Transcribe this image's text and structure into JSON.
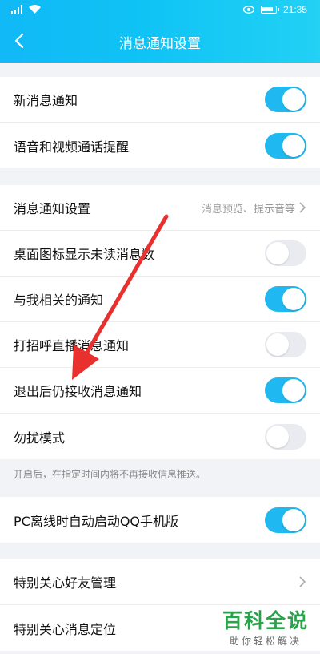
{
  "status_bar": {
    "time": "21:35",
    "icons": [
      "signal-icon",
      "wifi-icon",
      "eye-icon",
      "battery-icon"
    ]
  },
  "header": {
    "title": "消息通知设置",
    "back_icon": "chevron-left-icon"
  },
  "colors": {
    "header_start": "#11b9f6",
    "header_end": "#22d1f4",
    "toggle_on": "#20b8f0",
    "toggle_off": "#e9ebf0",
    "arrow": "#e8302e",
    "watermark": "#2aa24a"
  },
  "group1": {
    "items": [
      {
        "label": "新消息通知",
        "toggle": true
      },
      {
        "label": "语音和视频通话提醒",
        "toggle": true
      }
    ]
  },
  "group2": {
    "items": [
      {
        "label": "消息通知设置",
        "value": "消息预览、提示音等"
      },
      {
        "label": "桌面图标显示未读消息数",
        "toggle": false
      },
      {
        "label": "与我相关的通知",
        "toggle": true
      },
      {
        "label": "打招呼直播消息通知",
        "toggle": false
      },
      {
        "label": "退出后仍接收消息通知",
        "toggle": true
      },
      {
        "label": "勿扰模式",
        "toggle": false
      }
    ]
  },
  "hint": "开启后，在指定时间内将不再接收信息推送。",
  "group3": {
    "items": [
      {
        "label": "PC离线时自动启动QQ手机版",
        "toggle": true
      }
    ]
  },
  "group4": {
    "items": [
      {
        "label": "特别关心好友管理"
      },
      {
        "label": "特别关心消息定位"
      }
    ]
  },
  "watermark": {
    "title": "百科全说",
    "subtitle": "助你轻松解决"
  }
}
